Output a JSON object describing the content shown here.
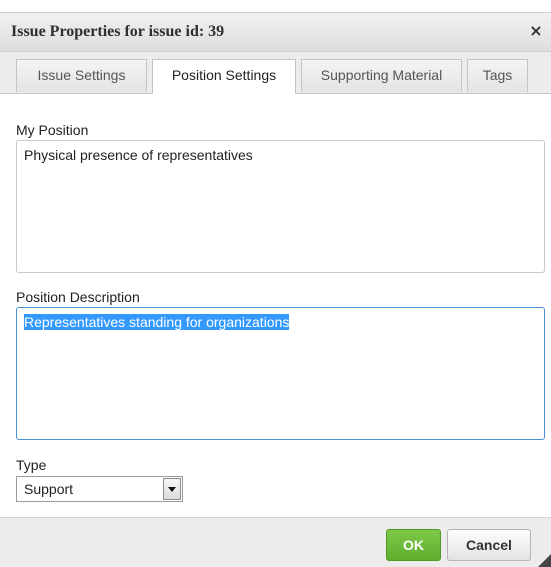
{
  "dialog": {
    "title": "Issue Properties for issue id: 39",
    "close_glyph": "×"
  },
  "tabs": [
    {
      "label": "Issue Settings",
      "active": false
    },
    {
      "label": "Position Settings",
      "active": true
    },
    {
      "label": "Supporting Material",
      "active": false
    },
    {
      "label": "Tags",
      "active": false
    }
  ],
  "form": {
    "my_position": {
      "label": "My Position",
      "value": "Physical presence of representatives"
    },
    "position_description": {
      "label": "Position Description",
      "value": "Representatives standing for organizations",
      "selected": true
    },
    "type": {
      "label": "Type",
      "value": "Support"
    }
  },
  "footer": {
    "ok_label": "OK",
    "cancel_label": "Cancel"
  },
  "colors": {
    "ok_button": "#6bbb3a",
    "selection": "#3399ff",
    "focus_border": "#4a8fd6"
  }
}
